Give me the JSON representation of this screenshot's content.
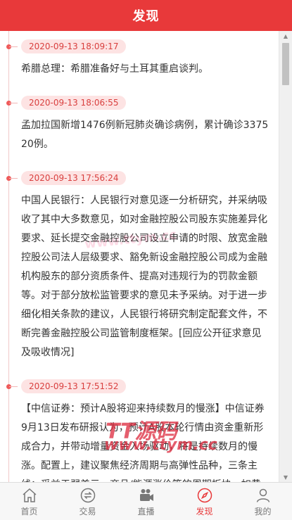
{
  "header": {
    "title": "发现"
  },
  "feed": [
    {
      "time": "2020-09-13 18:09:17",
      "text": "希腊总理：希腊准备好与土耳其重启谈判。"
    },
    {
      "time": "2020-09-13 18:06:55",
      "text": "孟加拉国新增1476例新冠肺炎确诊病例，累计确诊337520例。"
    },
    {
      "time": "2020-09-13 17:56:24",
      "text": "中国人民银行：人民银行对意见逐一分析研究，并采纳吸收了其中大多数意见，如对金融控股公司股东实施差异化要求、延长提交金融控股公司设立申请的时限、放宽金融控股公司法人层级要求、豁免新设金融控股公司成为金融机构股东的部分资质条件、提高对违规行为的罚款金额等。对于部分放松监管要求的意见未予采纳。对于进一步细化相关条款的建议，人民银行将研究制定配套文件，不断完善金融控股公司监管制度框架。[回应公开征求意见及吸收情况]"
    },
    {
      "time": "2020-09-13 17:51:52",
      "text": "【中信证券：预计A股将迎来持续数月的慢涨】中信证券9月13日发布研报认为，预计A股本轮行情由资金重新形成合力，并带动增量资金入场驱动，将是持续数月的慢涨。配置上，建议聚焦经济周期与高弹性品种，三条主线：受益于弱美元、商品/能源涨价等的周期板块，如黄金、有色金属和化工；受益于经济复苏和消费回暖的可选消费，如汽车、家电、家居等；绝"
    }
  ],
  "watermark": {
    "line1": "www.ttym.cc",
    "line2": "TT源码",
    "line3": "www.ttym.cc"
  },
  "tabs": [
    {
      "label": "首页",
      "icon": "home-icon"
    },
    {
      "label": "交易",
      "icon": "exchange-icon"
    },
    {
      "label": "直播",
      "icon": "video-camera-icon"
    },
    {
      "label": "发现",
      "icon": "compass-icon",
      "active": true
    },
    {
      "label": "我的",
      "icon": "user-icon"
    }
  ],
  "colors": {
    "accent": "#e8393a",
    "time_bg": "#fde3e3",
    "time_text": "#d9403f"
  }
}
